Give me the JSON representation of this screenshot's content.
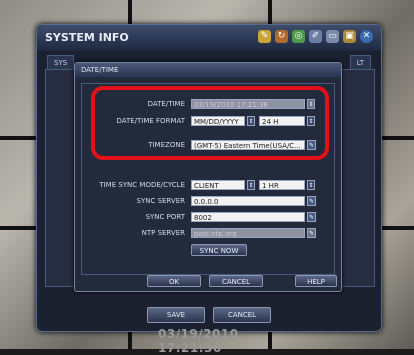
{
  "window": {
    "title": "SYSTEM INFO",
    "tab_left": "SYS",
    "tab_right": "LT"
  },
  "dialog": {
    "title": "DATE/TIME",
    "date_time_label": "DATE/TIME",
    "date_time_value": "03/19/2010 17:21:36",
    "format_label": "DATE/TIME FORMAT",
    "format_value": "MM/DD/YYYY",
    "hour_value": "24 H",
    "timezone_label": "TIMEZONE",
    "timezone_value": "(GMT-5) Eastern Time(USA/C...",
    "sync_mode_label": "TIME SYNC MODE/CYCLE",
    "sync_mode_value": "CLIENT",
    "sync_cycle_value": "1 HR",
    "sync_server_label": "SYNC SERVER",
    "sync_server_value": "0.0.0.0",
    "sync_port_label": "SYNC PORT",
    "sync_port_value": "8002",
    "ntp_server_label": "NTP SERVER",
    "ntp_server_value": "pool.ntp.org",
    "sync_now": "SYNC NOW",
    "ok": "OK",
    "cancel": "CANCEL",
    "help": "HELP"
  },
  "footer": {
    "save": "SAVE",
    "cancel": "CANCEL"
  },
  "clock": "03/19/2010 17:21:36",
  "colors": {
    "highlight": "#e3101a",
    "panel": "#222a3c",
    "title_bar": "#3e4c6c"
  },
  "icons": [
    "tool-icon",
    "refresh-icon",
    "globe-icon",
    "pencil-icon",
    "rectangle-icon",
    "lock-icon",
    "close-icon"
  ]
}
